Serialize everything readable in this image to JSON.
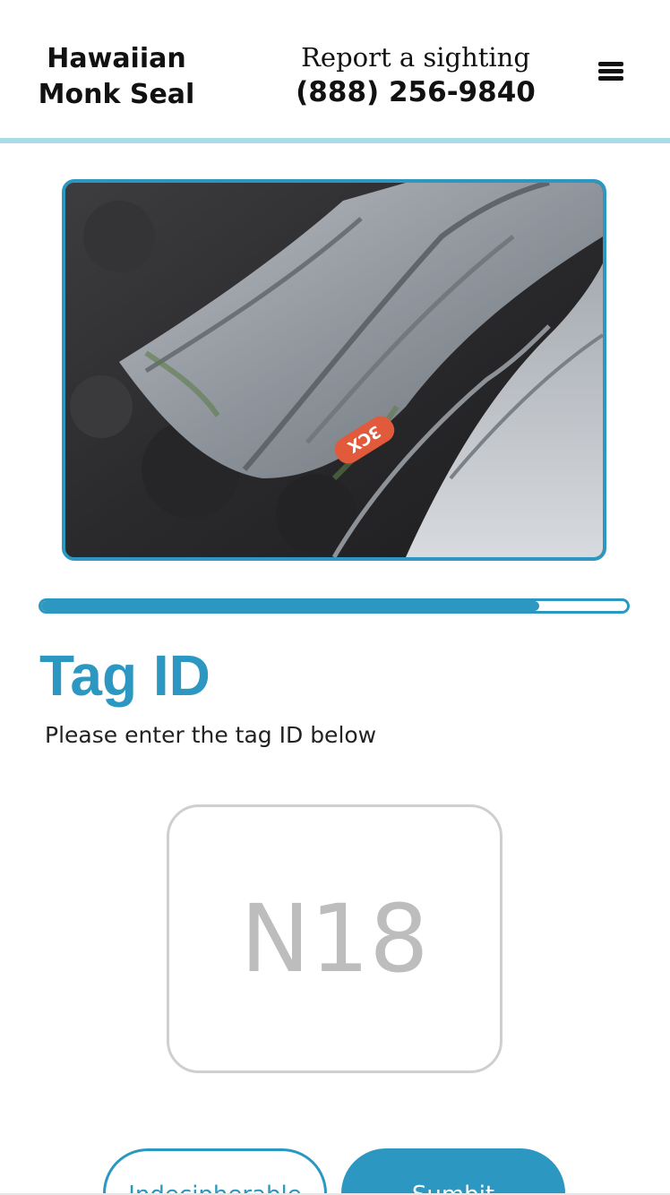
{
  "header": {
    "brand_line1": "Hawaiian",
    "brand_line2": "Monk Seal",
    "report_label": "Report a sighting",
    "report_phone": "(888) 256-9840",
    "menu_icon": "hamburger-menu-icon"
  },
  "photo": {
    "tag_text": "3CX"
  },
  "progress": {
    "fraction": 0.85
  },
  "form": {
    "title": "Tag ID",
    "subtitle": "Please enter the tag ID below",
    "tag_placeholder": "N18",
    "tag_value": ""
  },
  "buttons": {
    "indecipherable": "Indecipherable",
    "submit": "Sumbit"
  },
  "colors": {
    "accent": "#2c97c0",
    "header_border": "#a9dce6",
    "input_border": "#cfcfcf",
    "placeholder": "#bdbdbd"
  }
}
